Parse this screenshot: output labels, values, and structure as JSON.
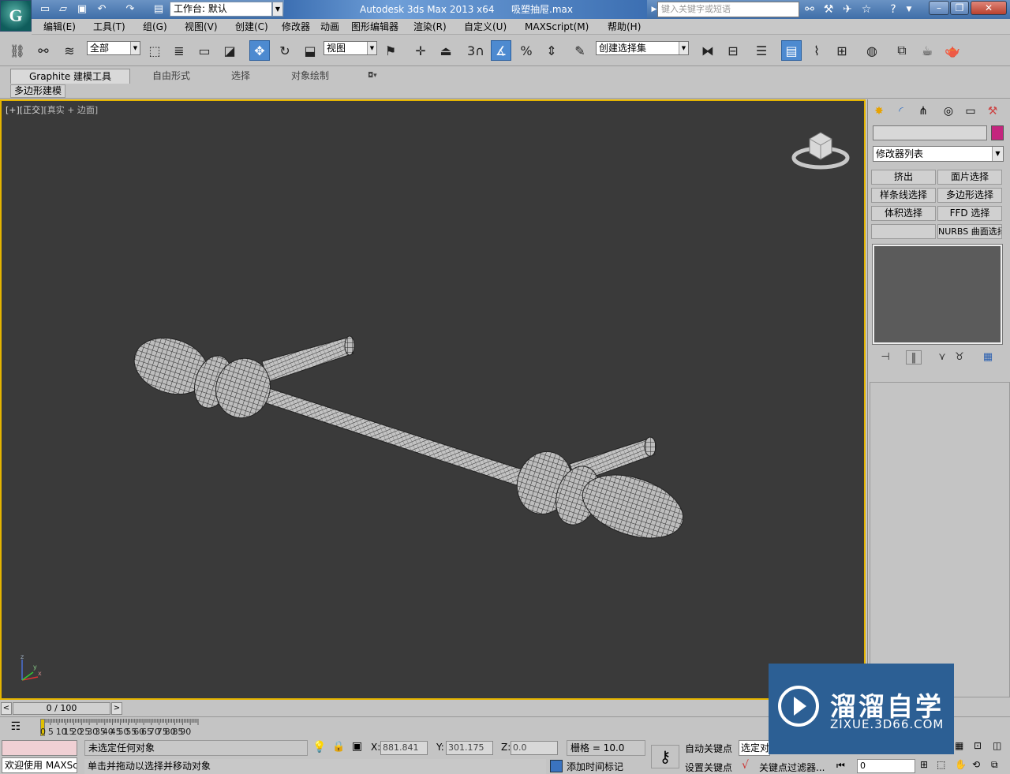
{
  "titlebar": {
    "workspace": "工作台: 默认",
    "app_name": "Autodesk 3ds Max  2013 x64",
    "file_name": "吸塑抽屉.max",
    "search_placeholder": "键入关键字或短语"
  },
  "menu": [
    "编辑(E)",
    "工具(T)",
    "组(G)",
    "视图(V)",
    "创建(C)",
    "修改器",
    "动画",
    "图形编辑器",
    "渲染(R)",
    "自定义(U)",
    "MAXScript(M)",
    "帮助(H)"
  ],
  "toolbar": {
    "filter": "全部",
    "ref_coord": "视图",
    "snap_number": "3",
    "selection_set": "创建选择集"
  },
  "ribbon": {
    "tabs": [
      "Graphite 建模工具",
      "自由形式",
      "选择",
      "对象绘制"
    ],
    "sub": "多边形建模"
  },
  "viewport": {
    "label_bracket1": "[+]",
    "label_bracket2": "[正交]",
    "label_mode": "[真实 + 边面]",
    "axis_z": "z",
    "axis_x": "x",
    "axis_y": "y"
  },
  "command_panel": {
    "modifier_list": "修改器列表",
    "buttons": [
      "挤出",
      "面片选择",
      "样条线选择",
      "多边形选择",
      "体积选择",
      "FFD 选择",
      "",
      "NURBS 曲面选择"
    ],
    "color": "#c4257e"
  },
  "timeslider": {
    "position": "0 / 100",
    "ticks": [
      "0",
      "5",
      "10",
      "15",
      "20",
      "25",
      "30",
      "35",
      "40",
      "45",
      "50",
      "55",
      "60",
      "65",
      "70",
      "75",
      "80",
      "85",
      "90"
    ]
  },
  "status": {
    "welcome": "欢迎使用 MAXSc",
    "line1": "未选定任何对象",
    "line2": "单击并拖动以选择并移动对象",
    "x_label": "X:",
    "x_value": "881.841",
    "y_label": "Y:",
    "y_value": "301.175",
    "z_label": "Z:",
    "z_value": "0.0",
    "grid": "栅格 = 10.0",
    "add_time_tag": "添加时间标记",
    "auto_key": "自动关键点",
    "set_key": "设置关键点",
    "selected": "选定对",
    "key_filters": "关键点过滤器...",
    "frame": "0"
  },
  "watermark": {
    "title": "溜溜自学",
    "url": "ZIXUE.3D66.COM"
  }
}
